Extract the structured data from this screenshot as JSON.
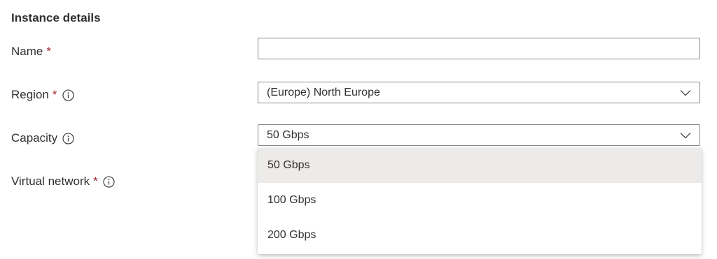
{
  "section": {
    "title": "Instance details"
  },
  "form": {
    "name": {
      "label": "Name",
      "required_mark": "*",
      "value": ""
    },
    "region": {
      "label": "Region",
      "required_mark": "*",
      "value": "(Europe) North Europe",
      "info_icon": "info-icon"
    },
    "capacity": {
      "label": "Capacity",
      "value": "50 Gbps",
      "info_icon": "info-icon",
      "options": [
        "50 Gbps",
        "100 Gbps",
        "200 Gbps"
      ],
      "selected_index": 0
    },
    "virtual_network": {
      "label": "Virtual network",
      "required_mark": "*",
      "info_icon": "info-icon"
    }
  },
  "colors": {
    "required": "#a4262c",
    "text": "#323130",
    "border": "#8a8886",
    "selected_option_bg": "#edebe9"
  }
}
